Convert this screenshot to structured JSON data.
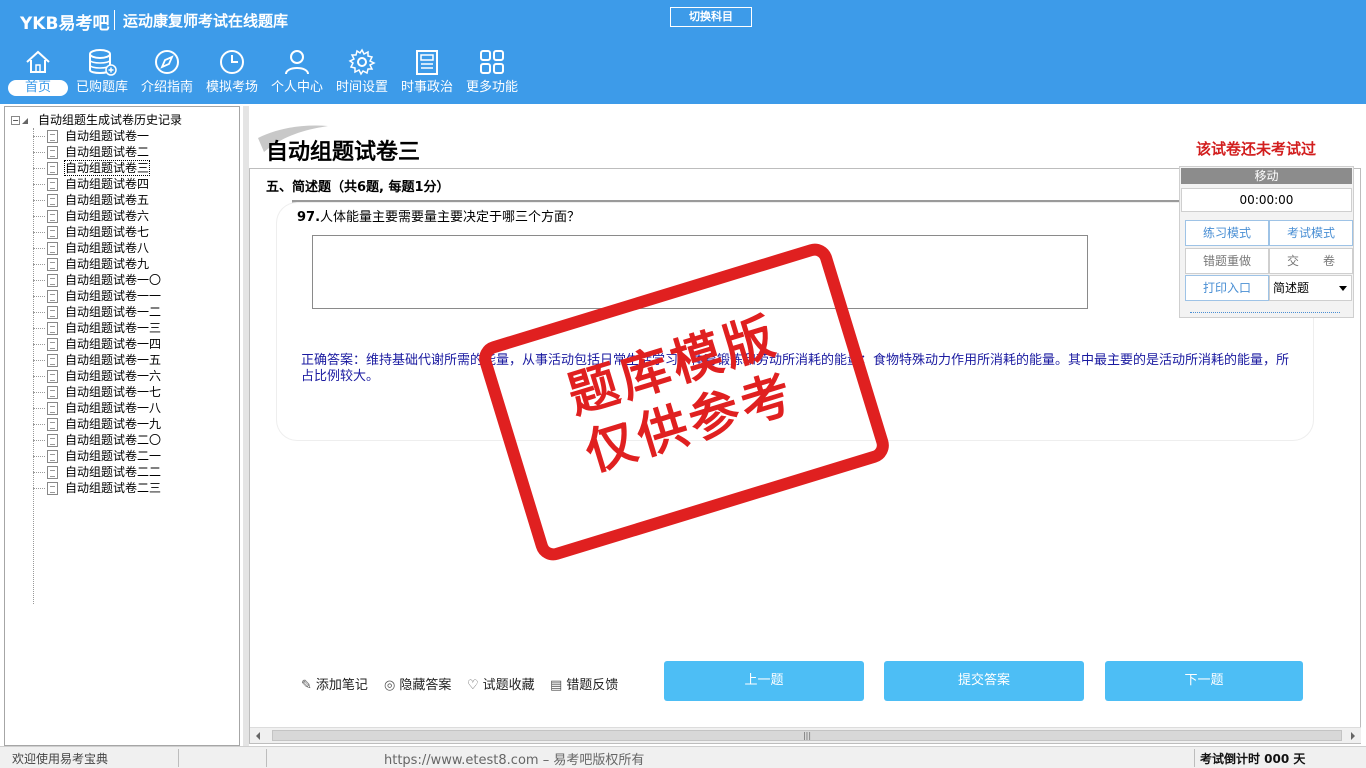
{
  "header": {
    "logo": "YKB易考吧",
    "app_title": "运动康复师考试在线题库",
    "switch_label": "切换科目",
    "nav": [
      {
        "label": "首页",
        "icon": "home-icon"
      },
      {
        "label": "已购题库",
        "icon": "database-icon"
      },
      {
        "label": "介绍指南",
        "icon": "compass-icon"
      },
      {
        "label": "模拟考场",
        "icon": "clock-icon"
      },
      {
        "label": "个人中心",
        "icon": "user-icon"
      },
      {
        "label": "时间设置",
        "icon": "gear-icon"
      },
      {
        "label": "时事政治",
        "icon": "newspaper-icon"
      },
      {
        "label": "更多功能",
        "icon": "grid-icon"
      }
    ]
  },
  "tree": {
    "root": "自动组题生成试卷历史记录",
    "items": [
      "自动组题试卷一",
      "自动组题试卷二",
      "自动组题试卷三",
      "自动组题试卷四",
      "自动组题试卷五",
      "自动组题试卷六",
      "自动组题试卷七",
      "自动组题试卷八",
      "自动组题试卷九",
      "自动组题试卷一〇",
      "自动组题试卷一一",
      "自动组题试卷一二",
      "自动组题试卷一三",
      "自动组题试卷一四",
      "自动组题试卷一五",
      "自动组题试卷一六",
      "自动组题试卷一七",
      "自动组题试卷一八",
      "自动组题试卷一九",
      "自动组题试卷二〇",
      "自动组题试卷二一",
      "自动组题试卷二二",
      "自动组题试卷二三"
    ],
    "selected_index": 2
  },
  "paper": {
    "title": "自动组题试卷三",
    "status": "该试卷还未考试过",
    "section_title": "五、简述题（共6题, 每题1分）",
    "question_number": "97.",
    "question_text": "人体能量主要需要量主要决定于哪三个方面？",
    "correct_answer": "正确答案：维持基础代谢所需的能量，从事活动包括日常生活学习、体育锻炼和劳动所消耗的能量；食物特殊动力作用所消耗的能量。其中最主要的是活动所消耗的能量，所占比例较大。"
  },
  "stamp": {
    "line1": "题库模版",
    "line2": "仅供参考"
  },
  "controls": {
    "move_label": "移动",
    "timer": "00:00:00",
    "practice_mode": "练习模式",
    "exam_mode": "考试模式",
    "redo_wrong": "错题重做",
    "submit_paper": "交　　卷",
    "print_entry": "打印入口",
    "type_select": "简述题"
  },
  "tools": {
    "add_note": "添加笔记",
    "hide_answer": "隐藏答案",
    "favorite": "试题收藏",
    "feedback": "错题反馈",
    "prev": "上一题",
    "submit_answer": "提交答案",
    "next": "下一题"
  },
  "statusbar": {
    "welcome": "欢迎使用易考宝典",
    "copyright": "https://www.etest8.com – 易考吧版权所有",
    "countdown": "考试倒计时 000 天"
  },
  "colors": {
    "header_bg": "#3d9be9",
    "button_blue": "#4dbef5",
    "stamp_red": "#e02020",
    "answer_blue": "#1a1aa0",
    "status_red": "#d21e1e"
  }
}
